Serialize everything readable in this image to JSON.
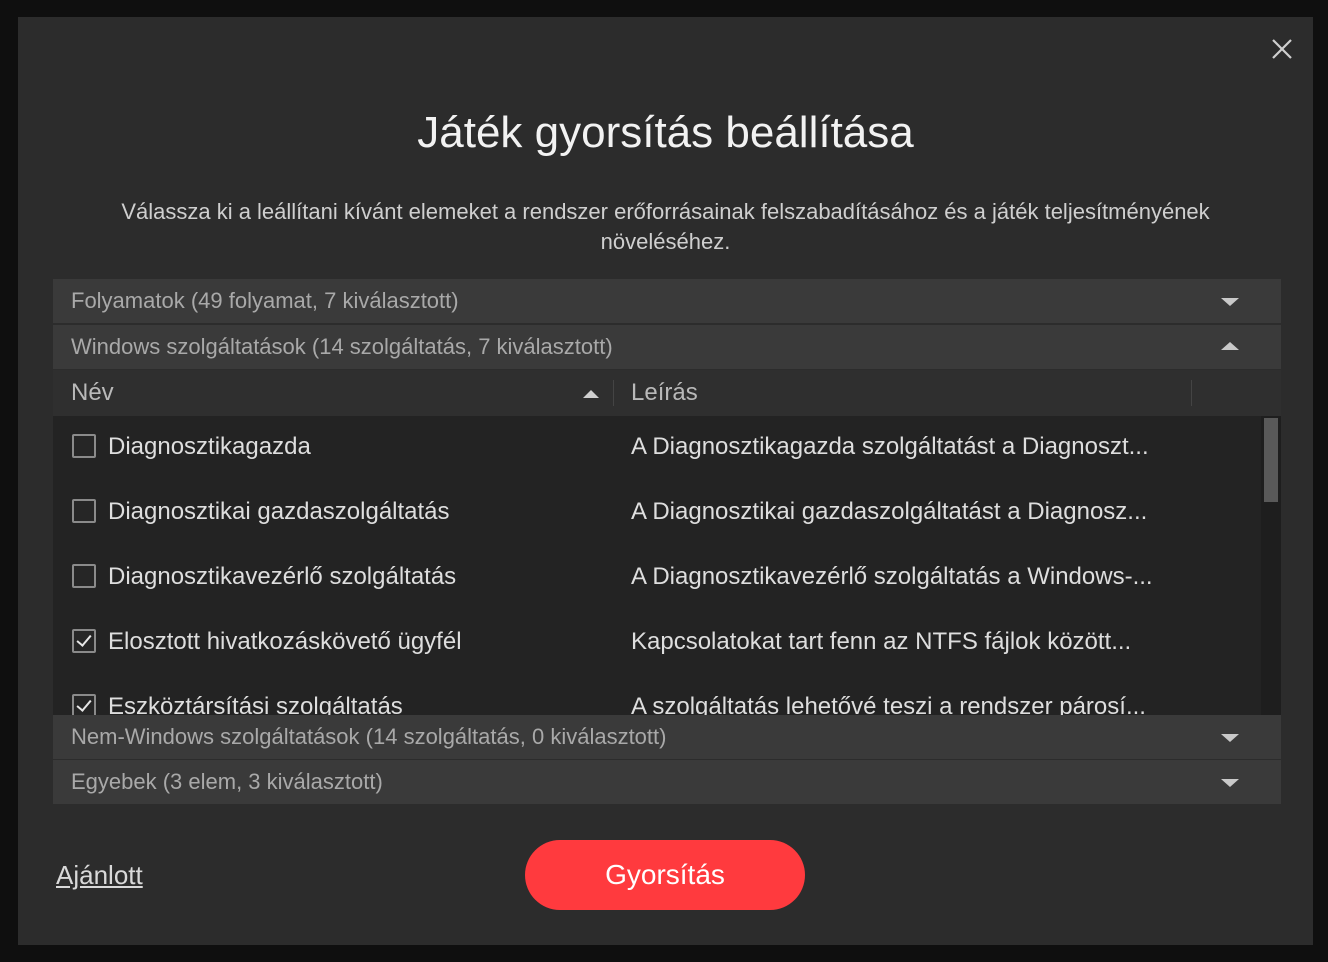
{
  "dialog": {
    "title": "Játék gyorsítás beállítása",
    "subtitle": "Válassza ki a leállítani kívánt elemeket a rendszer erőforrásainak felszabadításához és a játék teljesítményének növeléséhez.",
    "close_icon": "close-icon"
  },
  "sections": {
    "processes": {
      "label": "Folyamatok (49 folyamat, 7 kiválasztott)",
      "expanded": false
    },
    "windows_services": {
      "label": "Windows szolgáltatások (14 szolgáltatás, 7 kiválasztott)",
      "expanded": true
    },
    "non_windows_services": {
      "label": "Nem-Windows szolgáltatások (14 szolgáltatás, 0 kiválasztott)",
      "expanded": false
    },
    "others": {
      "label": "Egyebek (3 elem, 3 kiválasztott)",
      "expanded": false
    }
  },
  "table": {
    "columns": {
      "name": "Név",
      "description": "Leírás"
    },
    "sort": "name-ascending",
    "rows": [
      {
        "name": "Diagnosztikagazda",
        "description": "A Diagnosztikagazda szolgáltatást a Diagnoszt...",
        "checked": false
      },
      {
        "name": "Diagnosztikai gazdaszolgáltatás",
        "description": "A Diagnosztikai gazdaszolgáltatást a Diagnosz...",
        "checked": false
      },
      {
        "name": "Diagnosztikavezérlő szolgáltatás",
        "description": "A Diagnosztikavezérlő szolgáltatás a Windows-...",
        "checked": false
      },
      {
        "name": "Elosztott hivatkozáskövető ügyfél",
        "description": "Kapcsolatokat tart fenn az NTFS fájlok között...",
        "checked": true
      },
      {
        "name": "Eszköztársítási szolgáltatás",
        "description": "A szolgáltatás lehetővé teszi a rendszer párosí...",
        "checked": true
      }
    ]
  },
  "footer": {
    "recommended_label": "Ajánlott",
    "accelerate_label": "Gyorsítás"
  },
  "colors": {
    "accent": "#ff3a3e",
    "dialog_bg": "#2c2c2c",
    "section_bg": "#3a3a3a"
  }
}
